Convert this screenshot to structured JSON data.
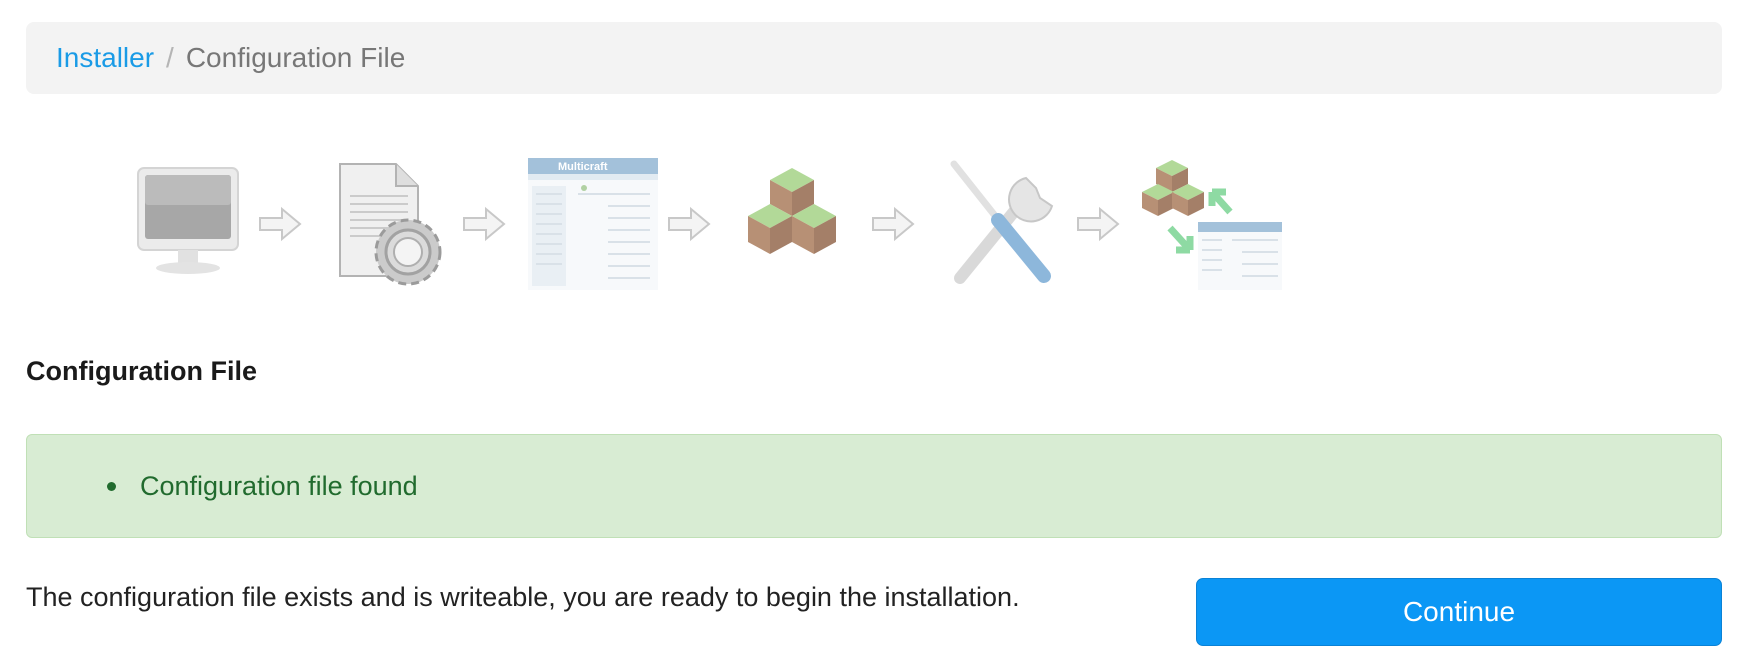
{
  "breadcrumb": {
    "root": "Installer",
    "separator": "/",
    "current": "Configuration File"
  },
  "steps": [
    {
      "icon": "monitor-icon"
    },
    {
      "icon": "config-file-icon"
    },
    {
      "icon": "control-panel-screenshot-icon",
      "caption": "Multicraft"
    },
    {
      "icon": "minecraft-blocks-icon"
    },
    {
      "icon": "tools-icon"
    },
    {
      "icon": "blocks-panel-icon"
    }
  ],
  "section": {
    "title": "Configuration File"
  },
  "alert": {
    "items": [
      "Configuration file found"
    ]
  },
  "message": "The configuration file exists and is writeable, you are ready to begin the installation.",
  "actions": {
    "continue_label": "Continue"
  },
  "colors": {
    "link": "#1a9be6",
    "alert_bg": "#d8ecd3",
    "alert_text": "#216b2e",
    "button": "#0b97f5"
  }
}
